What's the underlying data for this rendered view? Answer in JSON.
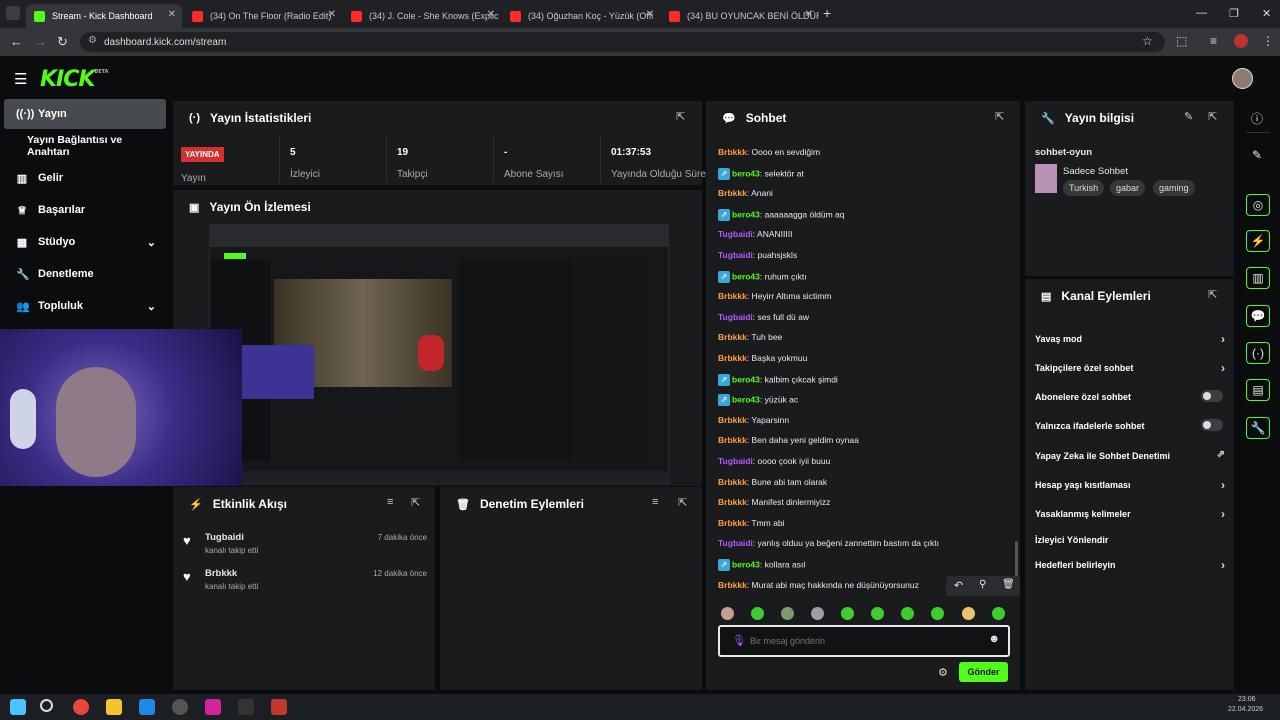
{
  "browser": {
    "tabs": [
      {
        "title": "Stream - Kick Dashboard",
        "color": "#53fc18"
      },
      {
        "title": "(34) On The Floor (Radio Edit)",
        "color": "#ff2b2b"
      },
      {
        "title": "(34) J. Cole - She Knows (Explic",
        "color": "#ff2b2b"
      },
      {
        "title": "(34) Oğuzhan Koç - Yüzük (Offi",
        "color": "#ff2b2b"
      },
      {
        "title": "(34) BU OYUNCAK BENİ ÖLDÜR",
        "color": "#ff2b2b"
      }
    ],
    "url": "dashboard.kick.com/stream"
  },
  "header": {
    "logo": "KICK",
    "logo_sup": "BETA"
  },
  "sidebar": {
    "items": [
      {
        "label": "Yayın",
        "icon": "broadcast-icon"
      },
      {
        "label": "Yayın Bağlantısı ve Anahtarı",
        "icon": ""
      },
      {
        "label": "Gelir",
        "icon": "chart-icon"
      },
      {
        "label": "Başarılar",
        "icon": "trophy-icon"
      },
      {
        "label": "Stüdyo",
        "icon": "grid-icon"
      },
      {
        "label": "Denetleme",
        "icon": "wrench-icon"
      },
      {
        "label": "Topluluk",
        "icon": "users-icon"
      }
    ]
  },
  "stats": {
    "title": "Yayın İstatistikleri",
    "live_badge": "YAYINDA",
    "live_label": "Yayın",
    "items": [
      {
        "value": "5",
        "label": "İzleyici"
      },
      {
        "value": "19",
        "label": "Takipçi"
      },
      {
        "value": "-",
        "label": "Abone Sayısı"
      },
      {
        "value": "01:37:53",
        "label": "Yayında Olduğu Süre"
      }
    ]
  },
  "preview": {
    "title": "Yayın Ön İzlemesi"
  },
  "activity": {
    "title": "Etkinlik Akışı",
    "items": [
      {
        "user": "Tugbaidi",
        "action": "kanalı takip etti",
        "time": "7 dakika önce"
      },
      {
        "user": "Brbkkk",
        "action": "kanalı takip etti",
        "time": "12 dakika önce"
      }
    ]
  },
  "moderation": {
    "title": "Denetim Eylemleri"
  },
  "chat": {
    "title": "Sohbet",
    "messages": [
      {
        "user": "Brbkkk",
        "text": ": Oooo en sevdiğim",
        "color": "#ff9f43",
        "badge": false
      },
      {
        "user": "bero43",
        "text": ": selektör at",
        "color": "#53fc18",
        "badge": true
      },
      {
        "user": "Brbkkk",
        "text": ": Anani",
        "color": "#ff9f43",
        "badge": false
      },
      {
        "user": "bero43",
        "text": ": aaaaaagga öldüm aq",
        "color": "#53fc18",
        "badge": true
      },
      {
        "user": "Tugbaidi",
        "text": ": ANANIIIII",
        "color": "#b05cff",
        "badge": false
      },
      {
        "user": "Tugbaidi",
        "text": ": puahsjskls",
        "color": "#b05cff",
        "badge": false
      },
      {
        "user": "bero43",
        "text": ": ruhum çıktı",
        "color": "#53fc18",
        "badge": true
      },
      {
        "user": "Brbkkk",
        "text": ": Heyirr Altıma sictimm",
        "color": "#ff9f43",
        "badge": false
      },
      {
        "user": "Tugbaidi",
        "text": ": ses full dü aw",
        "color": "#b05cff",
        "badge": false
      },
      {
        "user": "Brbkkk",
        "text": ": Tuh bee",
        "color": "#ff9f43",
        "badge": false
      },
      {
        "user": "Brbkkk",
        "text": ": Başka yokmuu",
        "color": "#ff9f43",
        "badge": false
      },
      {
        "user": "bero43",
        "text": ": kalbim çıkcak şimdi",
        "color": "#53fc18",
        "badge": true
      },
      {
        "user": "bero43",
        "text": ": yüzük ac",
        "color": "#53fc18",
        "badge": true
      },
      {
        "user": "Brbkkk",
        "text": ": Yaparsinn",
        "color": "#ff9f43",
        "badge": false
      },
      {
        "user": "Brbkkk",
        "text": ": Ben daha yeni geldim oynaa",
        "color": "#ff9f43",
        "badge": false
      },
      {
        "user": "Tugbaidi",
        "text": ": oooo çook iyii buuu",
        "color": "#b05cff",
        "badge": false
      },
      {
        "user": "Brbkkk",
        "text": ": Bune abi tam olarak",
        "color": "#ff9f43",
        "badge": false
      },
      {
        "user": "Brbkkk",
        "text": ": Manifest dinlermiyizz",
        "color": "#ff9f43",
        "badge": false
      },
      {
        "user": "Brbkkk",
        "text": ": Tmm abi",
        "color": "#ff9f43",
        "badge": false
      },
      {
        "user": "Tugbaidi",
        "text": ": yanlış olduu ya beğeni zannettim bastım da çıktı",
        "color": "#b05cff",
        "badge": false
      },
      {
        "user": "bero43",
        "text": ": kollara asıl",
        "color": "#53fc18",
        "badge": true
      },
      {
        "user": "Brbkkk",
        "text": ": Murat abi maç hakkında ne düşünüyorsunuz",
        "color": "#ff9f43",
        "badge": false
      }
    ],
    "placeholder": "Bir mesaj gönderin",
    "send_label": "Gönder"
  },
  "stream_info": {
    "title": "Yayın bilgisi",
    "stream_title": "sohbet-oyun",
    "category": "Sadece Sohbet",
    "tags": [
      "Turkish",
      "gabar",
      "gaming"
    ]
  },
  "channel_actions": {
    "title": "Kanal Eylemleri",
    "items": [
      {
        "label": "Yavaş mod",
        "control": "chevron"
      },
      {
        "label": "Takipçilere özel sohbet",
        "control": "chevron"
      },
      {
        "label": "Abonelere özel sohbet",
        "control": "toggle"
      },
      {
        "label": "Yalnızca ifadelerle sohbet",
        "control": "toggle"
      },
      {
        "label": "Yapay Zeka ile Sohbet Denetimi",
        "control": "external"
      },
      {
        "label": "Hesap yaşı kısıtlaması",
        "control": "chevron"
      },
      {
        "label": "Yasaklanmış kelimeler",
        "control": "chevron"
      },
      {
        "label": "İzleyici Yönlendir",
        "control": "none"
      },
      {
        "label": "Hedefleri belirleyin",
        "control": "chevron"
      }
    ]
  },
  "taskbar": {
    "time": "23:06",
    "date": "22.04.2026"
  }
}
